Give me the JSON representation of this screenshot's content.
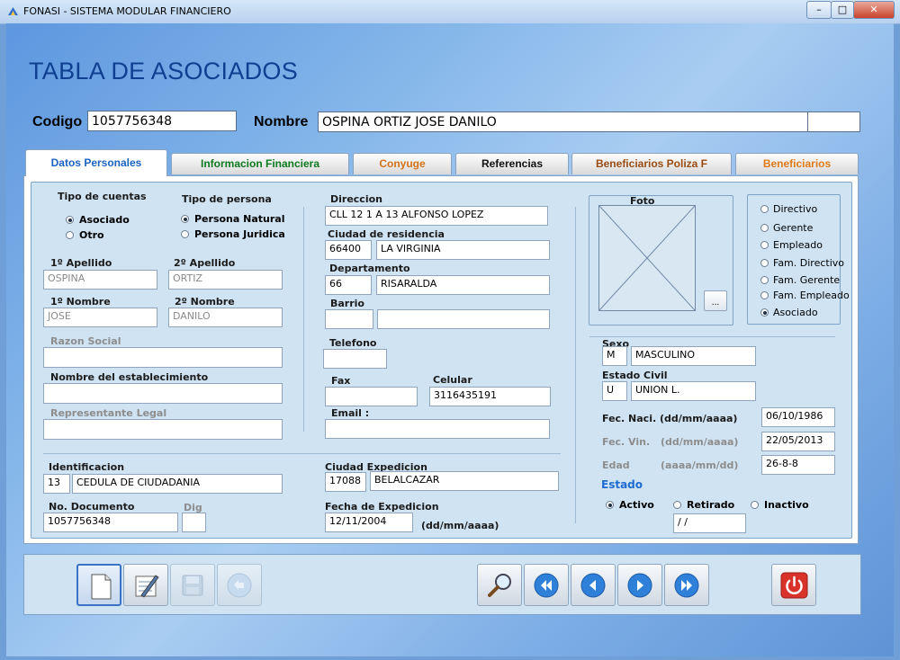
{
  "window": {
    "title": "FONASI - SISTEMA MODULAR FINANCIERO",
    "minimize": "–",
    "restore": "□",
    "close": "✕"
  },
  "page": {
    "title": "TABLA DE ASOCIADOS"
  },
  "header": {
    "codigo_label": "Codigo",
    "codigo_value": "1057756348",
    "nombre_label": "Nombre",
    "nombre_value": "OSPINA ORTIZ JOSE DANILO",
    "extra_value": ""
  },
  "tabs": [
    {
      "label": "Datos Personales",
      "color": "#1b63c0"
    },
    {
      "label": "Informacion Financiera",
      "color": "#0c7a1f"
    },
    {
      "label": "Conyuge",
      "color": "#d2731b"
    },
    {
      "label": "Referencias",
      "color": "#111111"
    },
    {
      "label": "Beneficiarios Poliza F",
      "color": "#9a4c12"
    },
    {
      "label": "Beneficiarios",
      "color": "#e07a19"
    }
  ],
  "personal": {
    "tipo_cuentas_label": "Tipo de  cuentas",
    "tipo_cuentas_options": [
      {
        "label": "Asociado",
        "selected": true
      },
      {
        "label": "Otro",
        "selected": false
      }
    ],
    "tipo_persona_label": "Tipo de persona",
    "tipo_persona_options": [
      {
        "label": "Persona Natural",
        "selected": true
      },
      {
        "label": "Persona Juridica",
        "selected": false
      }
    ],
    "apellido1_label": "1º Apellido",
    "apellido1_value": "OSPINA",
    "apellido2_label": "2º Apellido",
    "apellido2_value": "ORTIZ",
    "nombre1_label": "1º Nombre",
    "nombre1_value": "JOSE",
    "nombre2_label": "2º Nombre",
    "nombre2_value": "DANILO",
    "razon_social_label": "Razon Social",
    "razon_social_value": "",
    "establecimiento_label": "Nombre del establecimiento",
    "establecimiento_value": "",
    "representante_label": "Representante Legal",
    "representante_value": "",
    "identificacion_label": "Identificacion",
    "identificacion_code": "13",
    "identificacion_value": "CEDULA DE CIUDADANIA",
    "documento_label": "No. Documento",
    "documento_value": "1057756348",
    "dig_label": "Dig",
    "dig_value": ""
  },
  "contact": {
    "direccion_label": "Direccion",
    "direccion_value": "CLL 12 1 A 13 ALFONSO LOPEZ",
    "ciudad_label": "Ciudad de residencia",
    "ciudad_code": "66400",
    "ciudad_value": "LA VIRGINIA",
    "departamento_label": "Departamento",
    "departamento_code": "66",
    "departamento_value": "RISARALDA",
    "barrio_label": "Barrio",
    "barrio_code": "",
    "barrio_value": "",
    "telefono_label": "Telefono",
    "telefono_value": "",
    "fax_label": "Fax",
    "fax_value": "",
    "celular_label": "Celular",
    "celular_value": "3116435191",
    "email_label": "Email :",
    "email_value": "",
    "ciudad_exp_label": "Ciudad Expedicion",
    "ciudad_exp_code": "17088",
    "ciudad_exp_value": "BELALCAZAR",
    "fecha_exp_label": "Fecha de Expedicion",
    "fecha_exp_value": "12/11/2004",
    "fecha_exp_format": "(dd/mm/aaaa)"
  },
  "photo": {
    "label": "Foto",
    "browse_label": "..."
  },
  "role_options": [
    {
      "label": "Directivo",
      "selected": false
    },
    {
      "label": "Gerente",
      "selected": false
    },
    {
      "label": "Empleado",
      "selected": false
    },
    {
      "label": "Fam. Directivo",
      "selected": false
    },
    {
      "label": "Fam. Gerente",
      "selected": false
    },
    {
      "label": "Fam. Empleado",
      "selected": false
    },
    {
      "label": "Asociado",
      "selected": true
    }
  ],
  "status": {
    "sexo_label": "Sexo",
    "sexo_code": "M",
    "sexo_value": "MASCULINO",
    "estado_civil_label": "Estado Civil",
    "estado_civil_code": "U",
    "estado_civil_value": "UNION L.",
    "fec_naci_label": "Fec. Naci. (dd/mm/aaaa)",
    "fec_naci_value": "06/10/1986",
    "fec_vin_label": "Fec. Vin.",
    "fec_vin_format": "(dd/mm/aaaa)",
    "fec_vin_value": "22/05/2013",
    "edad_label": "Edad",
    "edad_format": "(aaaa/mm/dd)",
    "edad_value": "26-8-8",
    "estado_label": "Estado",
    "estado_options": [
      {
        "label": "Activo",
        "selected": true
      },
      {
        "label": "Retirado",
        "selected": false
      },
      {
        "label": "Inactivo",
        "selected": false
      }
    ],
    "estado_fecha_value": " /  /"
  },
  "toolbar": {
    "buttons": [
      "new-record",
      "edit-record",
      "save-record",
      "undo",
      "search",
      "first",
      "previous",
      "next",
      "last",
      "exit"
    ]
  },
  "colors": {
    "accent": "#1b63c0",
    "title": "#0f3f91",
    "panel": "#cfe3f3",
    "exit": "#d8322a"
  }
}
